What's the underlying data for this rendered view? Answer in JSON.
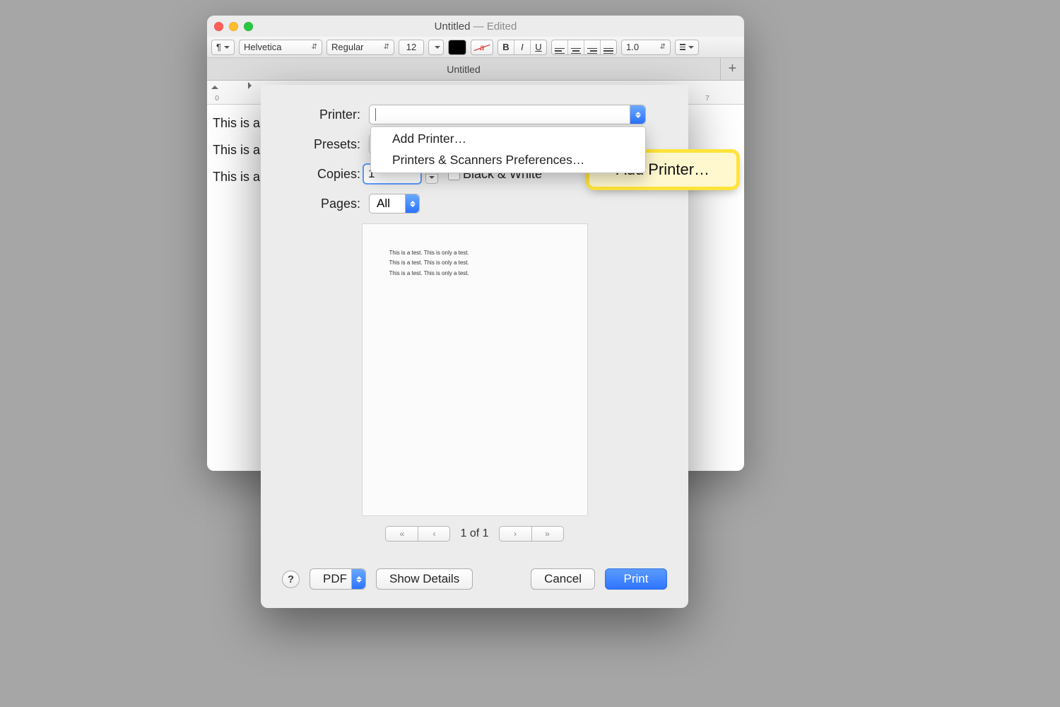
{
  "window": {
    "title_main": "Untitled",
    "title_suffix": " — Edited"
  },
  "toolbar": {
    "paragraph_menu": "¶",
    "font_family": "Helvetica",
    "font_style": "Regular",
    "font_size": "12",
    "line_spacing": "1.0",
    "bold": "B",
    "italic": "I",
    "underline": "U"
  },
  "tabstrip": {
    "tab_label": "Untitled",
    "plus": "+"
  },
  "ruler": {
    "ticks": [
      "0",
      "7"
    ]
  },
  "document_lines": [
    "This is a t",
    "This is a t",
    "This is a t"
  ],
  "print": {
    "labels": {
      "printer": "Printer:",
      "presets": "Presets:",
      "copies": "Copies:",
      "pages": "Pages:",
      "bw": "Black & White"
    },
    "copies_value": "1",
    "pages_value": "All",
    "menu_items": [
      "Add Printer…",
      "Printers & Scanners Preferences…"
    ],
    "preview_lines": [
      "This is a test. This is only a test.",
      "This is a test. This is only a test.",
      "This is a test. This is only a test."
    ],
    "pager_label": "1 of 1",
    "buttons": {
      "help": "?",
      "pdf": "PDF",
      "details": "Show Details",
      "cancel": "Cancel",
      "print": "Print"
    }
  },
  "callout": {
    "text": "Add Printer…"
  }
}
